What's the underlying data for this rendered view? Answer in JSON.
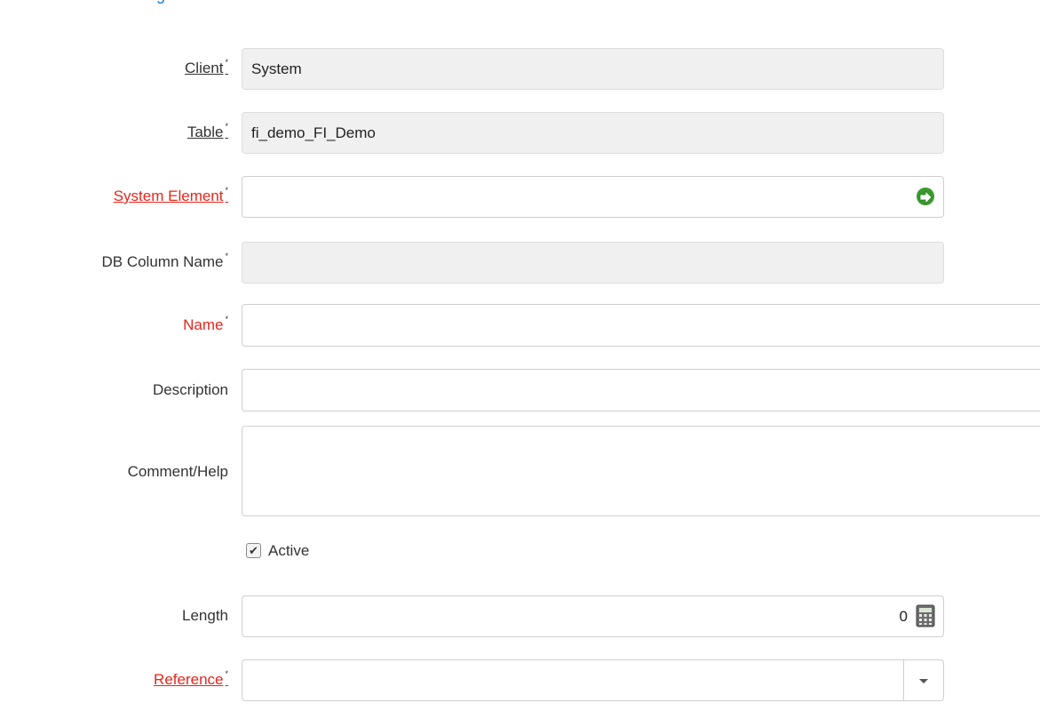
{
  "window": {
    "top_heading_fragment": "g"
  },
  "form": {
    "client": {
      "label": "Client",
      "mandatory_mark": "*",
      "value": "System"
    },
    "table": {
      "label": "Table",
      "mandatory_mark": "*",
      "value": "fi_demo_FI_Demo"
    },
    "system_element": {
      "label": "System Element",
      "mandatory_mark": "*",
      "value": "",
      "icon": "green-arrow-zoom-icon"
    },
    "db_column_name": {
      "label": "DB Column Name",
      "mandatory_mark": "*",
      "value": ""
    },
    "name": {
      "label": "Name",
      "mandatory_mark": "*",
      "value": ""
    },
    "description": {
      "label": "Description",
      "value": ""
    },
    "comment_help": {
      "label": "Comment/Help",
      "value": ""
    },
    "active": {
      "label": "Active",
      "checked": true
    },
    "length": {
      "label": "Length",
      "value": "0",
      "icon": "calculator-icon"
    },
    "reference": {
      "label": "Reference",
      "mandatory_mark": "*",
      "value": "",
      "icon": "caret-down-icon"
    }
  },
  "colors": {
    "mandatory_label": "#e8251a",
    "readonly_field_bg": "#f0f0f0",
    "field_border": "#cfcfcf",
    "zoom_icon_green": "#3a9a2c"
  }
}
